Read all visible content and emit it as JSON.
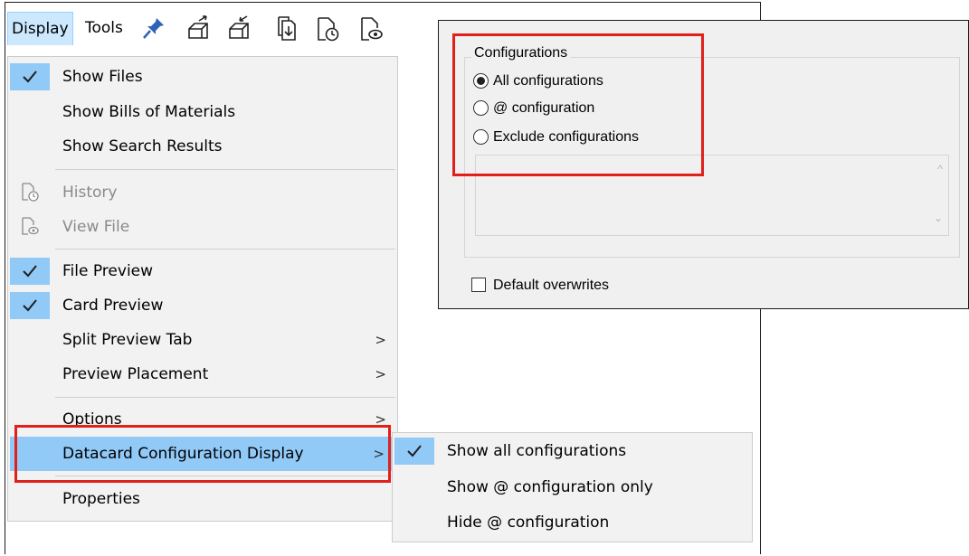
{
  "menubar": {
    "display_label": "Display",
    "tools_label": "Tools",
    "toolbar_icons": [
      "pin-icon",
      "check-in-icon",
      "check-out-icon",
      "get-latest-icon",
      "history-icon",
      "view-file-icon"
    ]
  },
  "display_menu": {
    "items": [
      {
        "label": "Show Files",
        "checked": true
      },
      {
        "label": "Show Bills of Materials"
      },
      {
        "label": "Show Search Results"
      },
      {
        "label": "History",
        "disabled": true,
        "icon": "history-icon"
      },
      {
        "label": "View File",
        "disabled": true,
        "icon": "view-file-icon"
      },
      {
        "label": "File Preview",
        "checked": true
      },
      {
        "label": "Card Preview",
        "checked": true
      },
      {
        "label": "Split Preview Tab",
        "submenu": true
      },
      {
        "label": "Preview Placement",
        "submenu": true
      },
      {
        "label": "Options",
        "submenu": true
      },
      {
        "label": "Datacard Configuration Display",
        "submenu": true,
        "highlighted": true
      },
      {
        "label": "Properties"
      }
    ],
    "arrow": ">"
  },
  "submenu": {
    "items": [
      {
        "label": "Show all configurations",
        "checked": true
      },
      {
        "label": "Show @ configuration only"
      },
      {
        "label": "Hide @ configuration"
      }
    ]
  },
  "config_panel": {
    "group_label": "Configurations",
    "radios": [
      {
        "label": "All configurations",
        "selected": true
      },
      {
        "label": "@ configuration",
        "selected": false
      },
      {
        "label": "Exclude configurations",
        "selected": false
      }
    ],
    "default_overwrites_label": "Default overwrites",
    "default_overwrites_checked": false
  },
  "colors": {
    "highlight": "#91c9f7",
    "menu_bg": "#f2f2f2",
    "annotation_red": "#e0201b",
    "menubar_active": "#cce8ff"
  }
}
